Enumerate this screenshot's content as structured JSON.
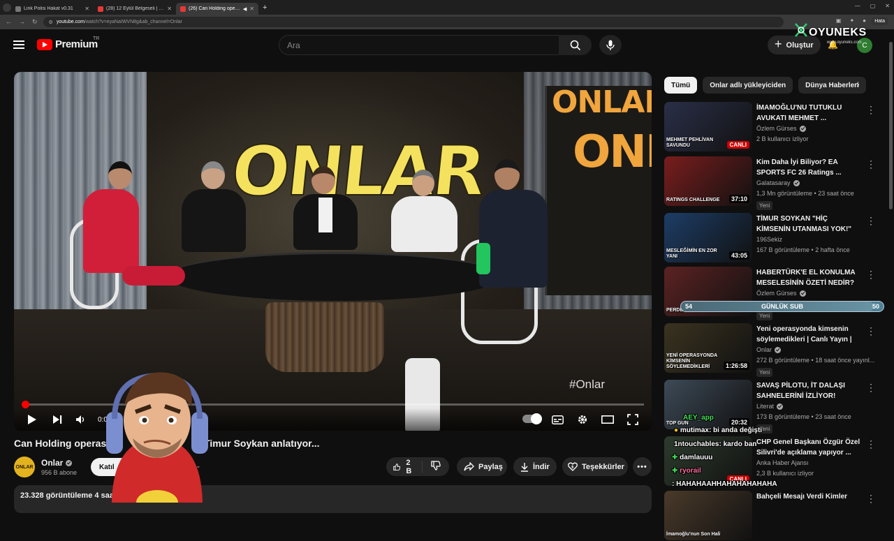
{
  "browser": {
    "tabs": [
      {
        "label": "Link Polisi Hakat v0.31"
      },
      {
        "label": "(28) 12 Eylül Belgeseli | 32..."
      },
      {
        "label": "(26) Can Holding operasyo..."
      }
    ],
    "url_host": "youtube.com",
    "url_rest": "/watch?v=eyaNaIWVN8g&ab_channel=Onlar",
    "error_badge": "Hata"
  },
  "header": {
    "logo_text": "Premium",
    "region": "TR",
    "search_placeholder": "Ara",
    "create_label": "Oluştur",
    "avatar_letter": "C"
  },
  "overlay_logo": {
    "name": "OYUNEKS",
    "url": "www.oyuneks.com"
  },
  "player": {
    "studio_sign": "ONLAR",
    "screen_sign_1": "ONLAR",
    "screen_sign_2": "ONL",
    "hashtag": "#Onlar",
    "time": "0:04 / 1",
    "progress": 0.002
  },
  "video": {
    "title_start": "Can Holding operas",
    "title_end": "| Timur Soykan anlatıyor...",
    "channel_name": "Onlar",
    "channel_avatar_text": "ONLAR",
    "subscribers": "956 B abone",
    "join_label": "Katıl",
    "likes": "2 B",
    "share_label": "Paylaş",
    "download_label": "İndir",
    "thanks_label": "Teşekkürler",
    "views_text": "23.328 görüntüleme  4 saat"
  },
  "chips": [
    "Tümü",
    "Onlar adlı yükleyiciden",
    "Dünya Haberleri"
  ],
  "recommendations": [
    {
      "title": "İMAMOĞLU'NU TUTUKLU AVUKATI MEHMET ...",
      "channel": "Özlem Gürses",
      "verified": true,
      "meta": "2 B kullanıcı izliyor",
      "badge": "CANLI",
      "thumb_caption": "MEHMET PEHLİVAN SAVUNDU",
      "thumb_bg": "#2a2f48"
    },
    {
      "title": "Kim Daha İyi Biliyor? EA SPORTS FC 26 Ratings ...",
      "channel": "Galatasaray",
      "verified": true,
      "meta": "1,3 Mn görüntüleme • 23 saat önce",
      "duration": "37:10",
      "new": "Yeni",
      "thumb_caption": "RATINGS CHALLENGE",
      "thumb_bg": "#7a1d1d"
    },
    {
      "title": "TİMUR SOYKAN \"HİÇ KİMSENİN UTANMASI YOK!\"",
      "channel": "196Sekiz",
      "verified": false,
      "meta": "167 B görüntüleme • 2 hafta önce",
      "duration": "43:05",
      "thumb_caption": "MESLEĞİMİN EN ZOR YANI",
      "thumb_bg": "#1d3d66"
    },
    {
      "title": "HABERTÜRK'E EL KONULMA MESELESİNİN ÖZETİ NEDİR? ...",
      "channel": "Özlem Gürses",
      "verified": true,
      "meta": "",
      "new": "Yeni",
      "thumb_caption": "PERDE ARKASINDA",
      "thumb_bg": "#5c2222"
    },
    {
      "title": "Yeni operasyonda kimsenin söylemedikleri | Canlı Yayın | 1...",
      "channel": "Onlar",
      "verified": true,
      "meta": "272 B görüntüleme • 18 saat önce yayınl...",
      "duration": "1:26:58",
      "new": "Yeni",
      "thumb_caption": "YENİ OPERASYONDA KİMSENİN SÖYLEMEDİKLERİ",
      "thumb_bg": "#3b3320"
    },
    {
      "title": "SAVAŞ PİLOTU, İT DALAŞI SAHNELERİNİ İZLİYOR!",
      "channel": "Literat",
      "verified": true,
      "meta": "173 B görüntüleme • 23 saat önce",
      "duration": "20:32",
      "new": "Yeni",
      "thumb_caption": "TOP GUN",
      "thumb_bg": "#3d4a57"
    },
    {
      "title": "CHP Genel Başkanı Özgür Özel Silivri'de açıklama yapıyor ...",
      "channel": "Anka Haber Ajansı",
      "verified": false,
      "meta": "2,3 B kullanıcı izliyor",
      "badge": "CANLI",
      "thumb_caption": "",
      "thumb_bg": "#2d3b2d"
    },
    {
      "title": "Bahçeli Mesajı Verdi Kimler",
      "channel": "",
      "verified": false,
      "meta": "",
      "thumb_caption": "İmamoğlu'nun Son Hali",
      "thumb_bg": "#4a3a2a"
    }
  ],
  "sub_goal": {
    "left": "54",
    "label": "GÜNLÜK SUB",
    "right": "50",
    "progress": 0.95
  },
  "chat": [
    {
      "user": "AEY_app",
      "text": ""
    },
    {
      "user": "mutimax",
      "text": ": bi anda değişti"
    },
    {
      "user": "1ntouchables",
      "text": ": kardo ban"
    },
    {
      "user": "damlauuu",
      "text": ""
    },
    {
      "user": "ryorail",
      "text": ""
    },
    {
      "user": "",
      "text": ": HAHAHAAHHAHAHAHAHAHA"
    }
  ],
  "colors": {
    "accent": "#ff0000",
    "bg": "#0f0f0f",
    "chip": "#272727"
  }
}
